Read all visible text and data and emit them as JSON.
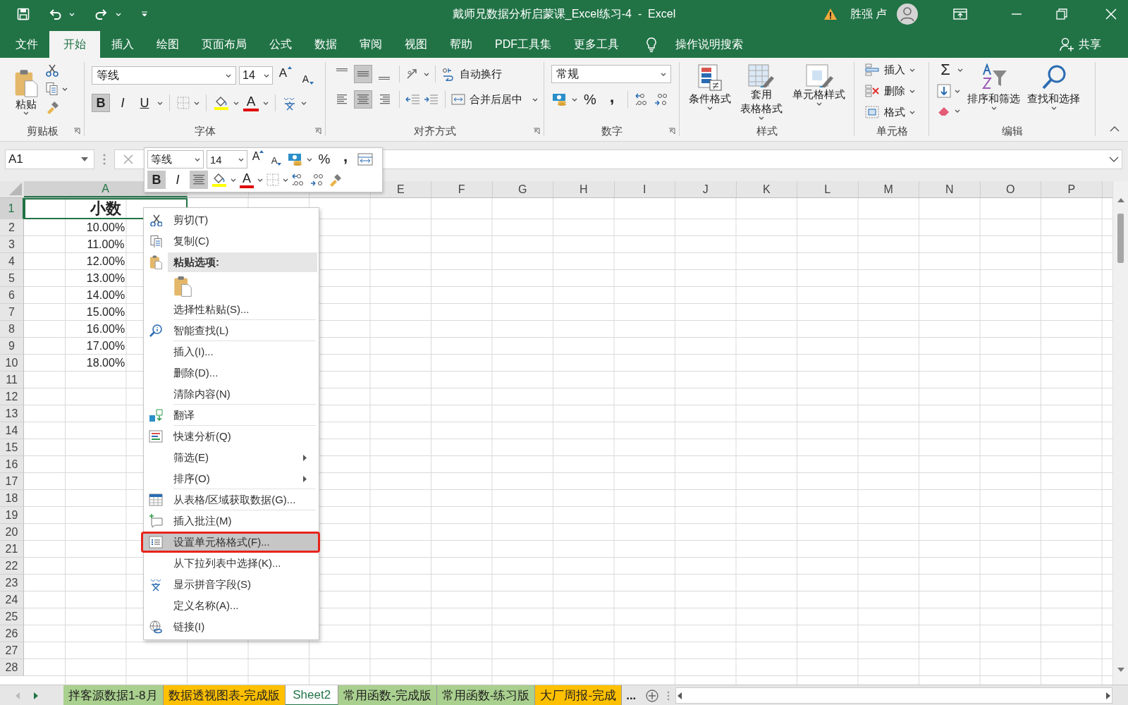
{
  "window": {
    "title": "戴师兄数据分析启蒙课_Excel练习-4  -  Excel",
    "user": "胜强 卢"
  },
  "menu_tabs": [
    {
      "label": "文件",
      "selected": false
    },
    {
      "label": "开始",
      "selected": true
    },
    {
      "label": "插入",
      "selected": false
    },
    {
      "label": "绘图",
      "selected": false
    },
    {
      "label": "页面布局",
      "selected": false
    },
    {
      "label": "公式",
      "selected": false
    },
    {
      "label": "数据",
      "selected": false
    },
    {
      "label": "审阅",
      "selected": false
    },
    {
      "label": "视图",
      "selected": false
    },
    {
      "label": "帮助",
      "selected": false
    },
    {
      "label": "PDF工具集",
      "selected": false
    },
    {
      "label": "更多工具",
      "selected": false
    }
  ],
  "tell_me": "操作说明搜索",
  "share": "共享",
  "ribbon": {
    "clipboard": {
      "label": "剪贴板",
      "paste": "粘贴"
    },
    "font": {
      "label": "字体",
      "name": "等线",
      "size": "14",
      "grow": "A",
      "shrink": "A",
      "font_color": "A",
      "buttons": [
        {
          "label": "B",
          "kind": "bold",
          "on": true
        },
        {
          "label": "I",
          "kind": "italic",
          "on": false
        },
        {
          "label": "U",
          "kind": "underline",
          "on": false
        }
      ]
    },
    "alignment": {
      "label": "对齐方式",
      "wrap": "自动换行",
      "merge": "合并后居中",
      "vertical": [
        {
          "kind": "top",
          "on": false
        },
        {
          "kind": "middle",
          "on": true
        },
        {
          "kind": "bottom",
          "on": false
        }
      ],
      "horizontal": [
        {
          "kind": "left",
          "on": false
        },
        {
          "kind": "center",
          "on": true
        },
        {
          "kind": "right",
          "on": false
        }
      ]
    },
    "number": {
      "label": "数字",
      "format": "常规",
      "percent": "%",
      "comma": ","
    },
    "styles": {
      "label": "样式",
      "buttons": [
        {
          "lines": [
            "条件格式"
          ]
        },
        {
          "lines": [
            "套用",
            "表格格式"
          ]
        },
        {
          "lines": [
            "单元格样式"
          ]
        }
      ]
    },
    "cells": {
      "label": "单元格",
      "buttons": [
        "插入",
        "删除",
        "格式"
      ]
    },
    "editing": {
      "label": "编辑",
      "sum": "Σ",
      "sort": "排序和筛选",
      "find": "查找和选择"
    }
  },
  "formula_bar": {
    "name_box": "A1"
  },
  "mini_toolbar": {
    "font": "等线",
    "size": "14",
    "grow": "A",
    "shrink": "A",
    "percent": "%",
    "comma": ",",
    "font_color": "A",
    "center": true,
    "buttons": [
      {
        "label": "B",
        "kind": "bold",
        "on": true
      },
      {
        "label": "I",
        "kind": "italic",
        "on": false
      }
    ]
  },
  "sheet": {
    "columns": [
      {
        "label": "A",
        "selected": true
      },
      {
        "selected": false
      },
      {
        "selected": false
      },
      {
        "selected": false
      },
      {
        "label": "E",
        "selected": false
      },
      {
        "label": "F",
        "selected": false
      },
      {
        "label": "G",
        "selected": false
      },
      {
        "label": "H",
        "selected": false
      },
      {
        "label": "I",
        "selected": false
      },
      {
        "label": "J",
        "selected": false
      },
      {
        "label": "K",
        "selected": false
      },
      {
        "label": "L",
        "selected": false
      },
      {
        "label": "M",
        "selected": false
      },
      {
        "label": "N",
        "selected": false
      },
      {
        "label": "O",
        "selected": false
      },
      {
        "label": "P",
        "selected": false
      }
    ],
    "rows": [
      {
        "label": "1",
        "selected": true,
        "value": "小数"
      },
      {
        "label": "2",
        "selected": false,
        "value": "10.00%"
      },
      {
        "label": "3",
        "selected": false,
        "value": "11.00%"
      },
      {
        "label": "4",
        "selected": false,
        "value": "12.00%"
      },
      {
        "label": "5",
        "selected": false,
        "value": "13.00%"
      },
      {
        "label": "6",
        "selected": false,
        "value": "14.00%"
      },
      {
        "label": "7",
        "selected": false,
        "value": "15.00%"
      },
      {
        "label": "8",
        "selected": false,
        "value": "16.00%"
      },
      {
        "label": "9",
        "selected": false,
        "value": "17.00%"
      },
      {
        "label": "10",
        "selected": false,
        "value": "18.00%"
      },
      {
        "label": "11",
        "selected": false
      },
      {
        "label": "12",
        "selected": false
      },
      {
        "label": "13",
        "selected": false
      },
      {
        "label": "14",
        "selected": false
      },
      {
        "label": "15",
        "selected": false
      },
      {
        "label": "16",
        "selected": false
      },
      {
        "label": "17",
        "selected": false
      },
      {
        "label": "18",
        "selected": false
      },
      {
        "label": "19",
        "selected": false
      },
      {
        "label": "20",
        "selected": false
      },
      {
        "label": "21",
        "selected": false
      },
      {
        "label": "22",
        "selected": false
      },
      {
        "label": "23",
        "selected": false
      },
      {
        "label": "24",
        "selected": false
      },
      {
        "label": "25",
        "selected": false
      },
      {
        "label": "26",
        "selected": false
      },
      {
        "label": "27",
        "selected": false
      },
      {
        "label": "28",
        "selected": false
      }
    ]
  },
  "context_menu": {
    "items": [
      {
        "kind": "command",
        "label": "剪切(T)",
        "separator": false,
        "selected": false,
        "outlined": false
      },
      {
        "kind": "command",
        "label": "复制(C)",
        "separator": false,
        "selected": false,
        "outlined": false
      },
      {
        "kind": "header",
        "label": "粘贴选项:",
        "separator": false,
        "selected": false,
        "outlined": false
      },
      {
        "kind": "paste_options",
        "separator": false
      },
      {
        "kind": "command",
        "label": "选择性粘贴(S)...",
        "separator": true,
        "selected": false,
        "outlined": false
      },
      {
        "kind": "command",
        "label": "智能查找(L)",
        "separator": true,
        "selected": false,
        "outlined": false
      },
      {
        "kind": "command",
        "label": "插入(I)...",
        "separator": false,
        "selected": false,
        "outlined": false
      },
      {
        "kind": "command",
        "label": "删除(D)...",
        "separator": false,
        "selected": false,
        "outlined": false
      },
      {
        "kind": "command",
        "label": "清除内容(N)",
        "separator": true,
        "selected": false,
        "outlined": false
      },
      {
        "kind": "command",
        "label": "翻译",
        "separator": true,
        "selected": false,
        "outlined": false
      },
      {
        "kind": "command",
        "label": "快速分析(Q)",
        "separator": false,
        "selected": false,
        "outlined": false
      },
      {
        "kind": "submenu",
        "label": "筛选(E)",
        "separator": false,
        "selected": false,
        "outlined": false
      },
      {
        "kind": "submenu",
        "label": "排序(O)",
        "separator": true,
        "selected": false,
        "outlined": false
      },
      {
        "kind": "command",
        "label": "从表格/区域获取数据(G)...",
        "separator": true,
        "selected": false,
        "outlined": false
      },
      {
        "kind": "command",
        "label": "插入批注(M)",
        "separator": false,
        "selected": false,
        "outlined": false
      },
      {
        "kind": "command",
        "label": "设置单元格格式(F)...",
        "separator": false,
        "selected": true,
        "outlined": true
      },
      {
        "kind": "command",
        "label": "从下拉列表中选择(K)...",
        "separator": false,
        "selected": false,
        "outlined": false
      },
      {
        "kind": "command",
        "label": "显示拼音字段(S)",
        "separator": false,
        "selected": false,
        "outlined": false
      },
      {
        "kind": "command",
        "label": "定义名称(A)...",
        "separator": false,
        "selected": false,
        "outlined": false
      },
      {
        "kind": "command",
        "label": "链接(I)",
        "separator": false,
        "selected": false,
        "outlined": false
      }
    ]
  },
  "sheet_tabs": {
    "tabs": [
      {
        "label": "拌客源数据1-8月",
        "selected": false,
        "color": "#a9d08e"
      },
      {
        "label": "数据透视图表-完成版",
        "selected": false,
        "color": "#ffc000"
      },
      {
        "label": "Sheet2",
        "selected": true
      },
      {
        "label": "常用函数-完成版",
        "selected": false,
        "color": "#a9d08e"
      },
      {
        "label": "常用函数-练习版",
        "selected": false,
        "color": "#a9d08e"
      },
      {
        "label": "大厂周报-完成",
        "selected": false,
        "color": "#ffc000"
      }
    ],
    "more": "..."
  }
}
